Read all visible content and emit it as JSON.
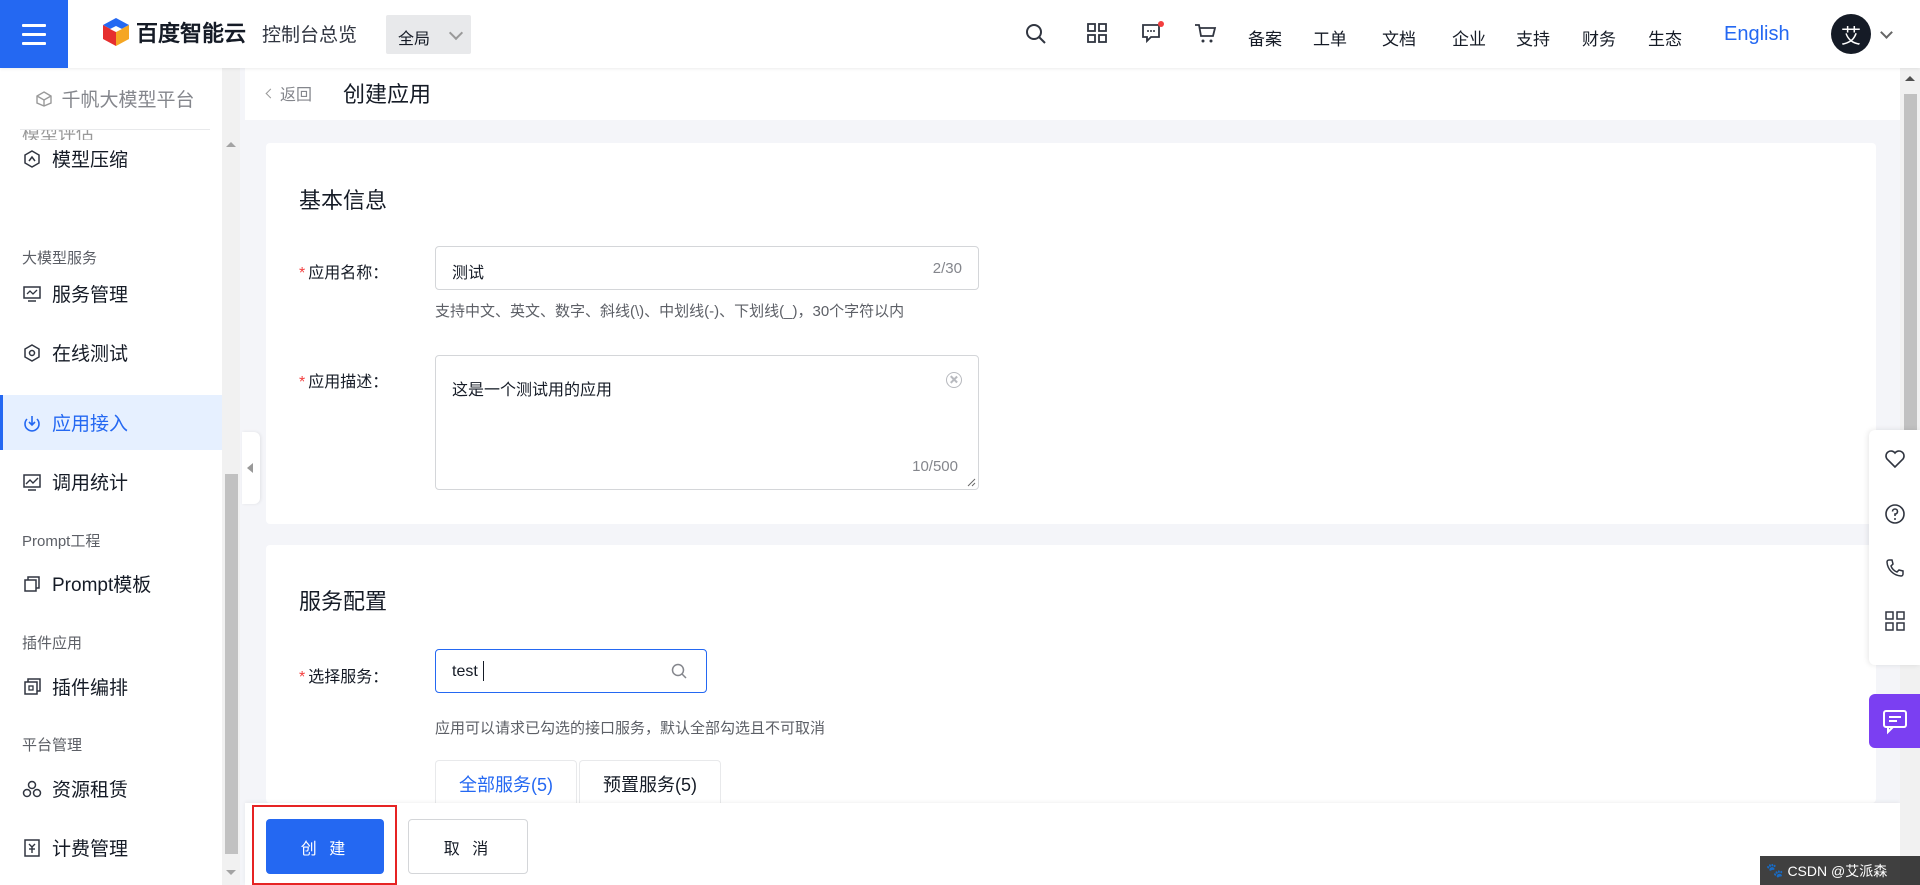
{
  "topbar": {
    "brand": "百度智能云",
    "console_title": "控制台总览",
    "region": "全局",
    "nav": [
      "备案",
      "工单",
      "文档",
      "企业",
      "支持",
      "财务",
      "生态"
    ],
    "lang": "English",
    "avatar_initial": "艾",
    "accent": "#2468f2"
  },
  "sidebar": {
    "platform": "千帆大模型平台",
    "truncated_item": "模型评估",
    "items": [
      {
        "label": "模型压缩",
        "icon": "compress-icon"
      },
      {
        "group": "大模型服务"
      },
      {
        "label": "服务管理",
        "icon": "service-icon"
      },
      {
        "label": "在线测试",
        "icon": "test-icon"
      },
      {
        "label": "应用接入",
        "icon": "app-access-icon",
        "active": true
      },
      {
        "label": "调用统计",
        "icon": "stats-icon"
      },
      {
        "group": "Prompt工程"
      },
      {
        "label": "Prompt模板",
        "icon": "template-icon"
      },
      {
        "group": "插件应用"
      },
      {
        "label": "插件编排",
        "icon": "plugin-icon"
      },
      {
        "group": "平台管理"
      },
      {
        "label": "资源租赁",
        "icon": "resource-icon"
      },
      {
        "label": "计费管理",
        "icon": "billing-icon"
      }
    ]
  },
  "page": {
    "back": "返回",
    "title": "创建应用"
  },
  "basic": {
    "title": "基本信息",
    "name_label": "应用名称：",
    "name_value": "测试",
    "name_counter": "2/30",
    "name_hint": "支持中文、英文、数字、斜线(\\)、中划线(-)、下划线(_)，30个字符以内",
    "desc_label": "应用描述：",
    "desc_value": "这是一个测试用的应用",
    "desc_counter": "10/500"
  },
  "service": {
    "title": "服务配置",
    "select_label": "选择服务：",
    "search_value": "test",
    "hint": "应用可以请求已勾选的接口服务，默认全部勾选且不可取消",
    "tabs": [
      "全部服务(5)",
      "预置服务(5)"
    ]
  },
  "footer": {
    "create": "创 建",
    "cancel": "取 消"
  },
  "watermark": "CSDN @艾派森"
}
